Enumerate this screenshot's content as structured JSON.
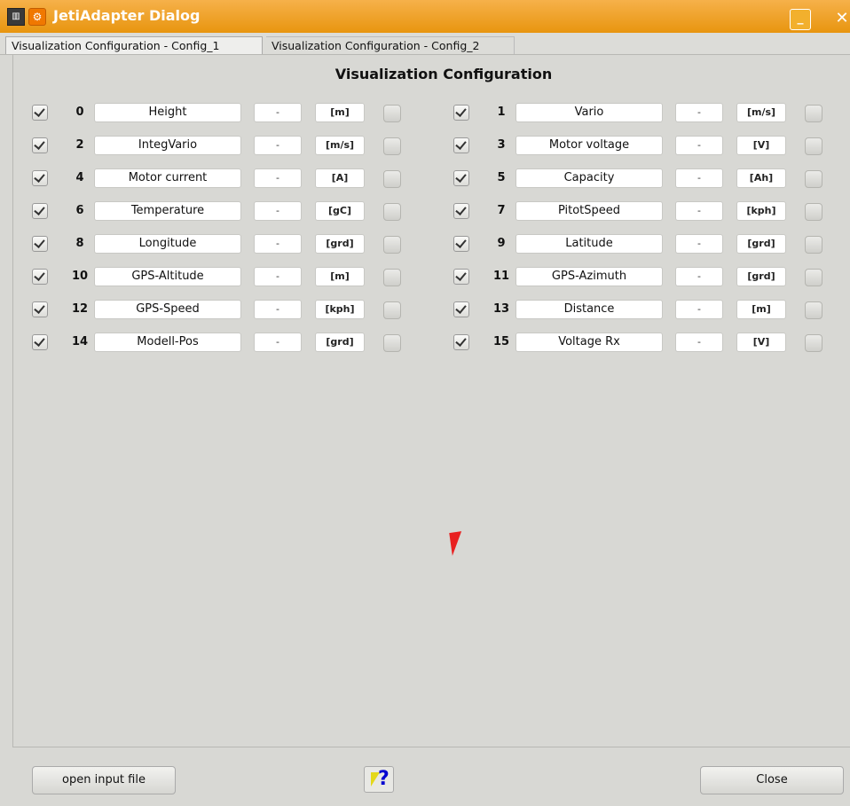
{
  "window": {
    "title": "JetiAdapter Dialog",
    "minimize_label": "_",
    "close_label": "✕"
  },
  "tabs": [
    "Visualization Configuration - Config_1",
    "Visualization Configuration - Config_2"
  ],
  "main": {
    "heading": "Visualization Configuration"
  },
  "sensors": [
    {
      "id": "0",
      "name": "Height",
      "value": "-",
      "unit": "[m]",
      "checked": true
    },
    {
      "id": "1",
      "name": "Vario",
      "value": "-",
      "unit": "[m/s]",
      "checked": true
    },
    {
      "id": "2",
      "name": "IntegVario",
      "value": "-",
      "unit": "[m/s]",
      "checked": true
    },
    {
      "id": "3",
      "name": "Motor voltage",
      "value": "-",
      "unit": "[V]",
      "checked": true
    },
    {
      "id": "4",
      "name": "Motor current",
      "value": "-",
      "unit": "[A]",
      "checked": true
    },
    {
      "id": "5",
      "name": "Capacity",
      "value": "-",
      "unit": "[Ah]",
      "checked": true
    },
    {
      "id": "6",
      "name": "Temperature",
      "value": "-",
      "unit": "[gC]",
      "checked": true
    },
    {
      "id": "7",
      "name": "PitotSpeed",
      "value": "-",
      "unit": "[kph]",
      "checked": true
    },
    {
      "id": "8",
      "name": "Longitude",
      "value": "-",
      "unit": "[grd]",
      "checked": true
    },
    {
      "id": "9",
      "name": "Latitude",
      "value": "-",
      "unit": "[grd]",
      "checked": true
    },
    {
      "id": "10",
      "name": "GPS-Altitude",
      "value": "-",
      "unit": "[m]",
      "checked": true
    },
    {
      "id": "11",
      "name": "GPS-Azimuth",
      "value": "-",
      "unit": "[grd]",
      "checked": true
    },
    {
      "id": "12",
      "name": "GPS-Speed",
      "value": "-",
      "unit": "[kph]",
      "checked": true
    },
    {
      "id": "13",
      "name": "Distance",
      "value": "-",
      "unit": "[m]",
      "checked": true
    },
    {
      "id": "14",
      "name": "Modell-Pos",
      "value": "-",
      "unit": "[grd]",
      "checked": true
    },
    {
      "id": "15",
      "name": "Voltage Rx",
      "value": "-",
      "unit": "[V]",
      "checked": true
    }
  ],
  "footer": {
    "open_label": "open input file",
    "help_label": "?",
    "close_label": "Close"
  },
  "colors": {
    "titlebar": "#e8950f",
    "background": "#d8d8d4",
    "cursor": "#e82020",
    "help_q": "#0000d0"
  },
  "icons": [
    "app-icon",
    "settings-icon",
    "whats-this-help-icon",
    "mouse-cursor-icon"
  ]
}
